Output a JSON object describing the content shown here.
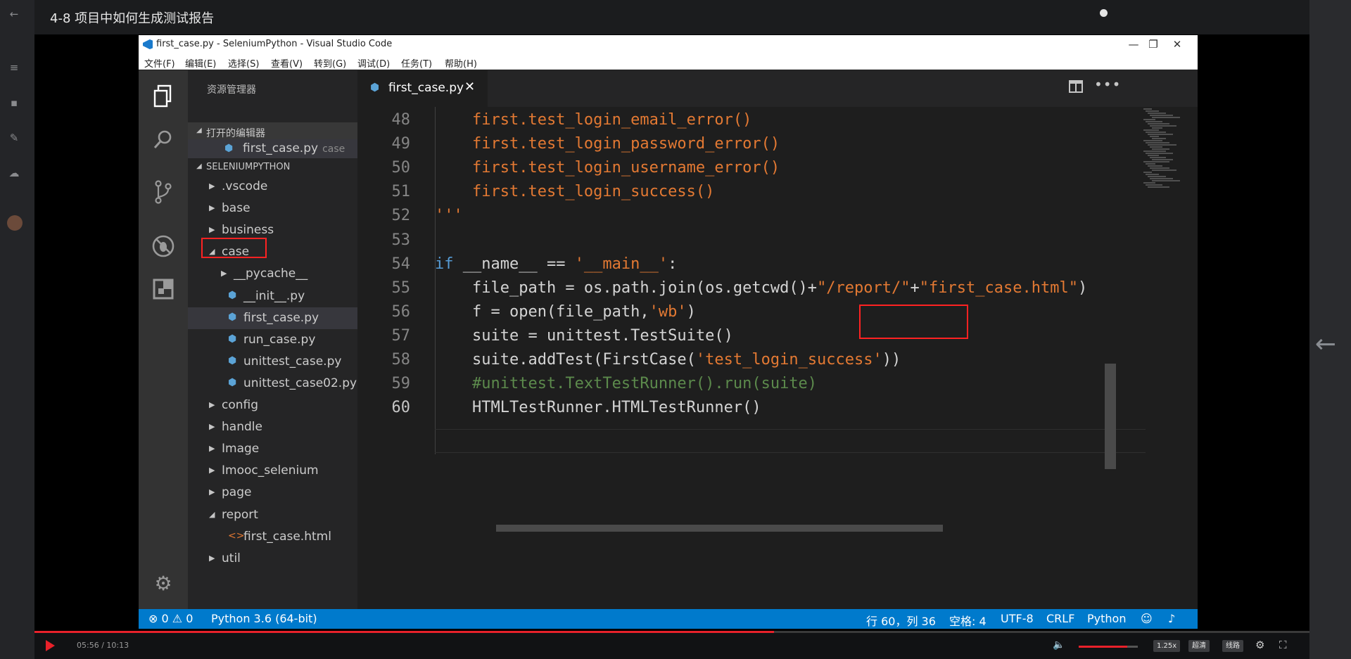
{
  "page": {
    "lesson_title": "4-8 项目中如何生成测试报告"
  },
  "player": {
    "current_time": "05:56",
    "duration": "10:13",
    "time_display": "05:56 / 10:13",
    "progress_fraction": 0.58,
    "volume_fraction": 0.82,
    "speed_label": "1.25x",
    "quality_label": "超清",
    "route_label": "线路",
    "accent_color": "#e8212a"
  },
  "window": {
    "title": "first_case.py - SeleniumPython - Visual Studio Code",
    "minimize": "—",
    "maximize": "❐",
    "close": "✕"
  },
  "menu": [
    "文件(F)",
    "编辑(E)",
    "选择(S)",
    "查看(V)",
    "转到(G)",
    "调试(D)",
    "任务(T)",
    "帮助(H)"
  ],
  "sidebar": {
    "title": "资源管理器",
    "open_editors_label": "打开的编辑器",
    "open_editor": {
      "name": "first_case.py",
      "folder": "case"
    },
    "workspace_label": "SELENIUMPYTHON",
    "tree": [
      {
        "name": ".vscode",
        "kind": "folder",
        "expanded": false
      },
      {
        "name": "base",
        "kind": "folder",
        "expanded": false
      },
      {
        "name": "business",
        "kind": "folder",
        "expanded": false
      },
      {
        "name": "case",
        "kind": "folder",
        "expanded": true
      },
      {
        "name": "__pycache__",
        "kind": "folder",
        "expanded": false
      },
      {
        "name": "__init__.py",
        "kind": "python"
      },
      {
        "name": "first_case.py",
        "kind": "python",
        "selected": true
      },
      {
        "name": "run_case.py",
        "kind": "python"
      },
      {
        "name": "unittest_case.py",
        "kind": "python"
      },
      {
        "name": "unittest_case02.py",
        "kind": "python"
      },
      {
        "name": "config",
        "kind": "folder",
        "expanded": false
      },
      {
        "name": "handle",
        "kind": "folder",
        "expanded": false
      },
      {
        "name": "Image",
        "kind": "folder",
        "expanded": false
      },
      {
        "name": "Imooc_selenium",
        "kind": "folder",
        "expanded": false
      },
      {
        "name": "page",
        "kind": "folder",
        "expanded": false
      },
      {
        "name": "report",
        "kind": "folder",
        "expanded": true
      },
      {
        "name": "first_case.html",
        "kind": "html"
      },
      {
        "name": "util",
        "kind": "folder",
        "expanded": false
      }
    ]
  },
  "editor": {
    "tab_label": "first_case.py",
    "tab_close": "✕",
    "current_line": "60",
    "lines": [
      {
        "n": "48",
        "segs": [
          [
            "fn",
            "    first.test_login_email_error()"
          ]
        ]
      },
      {
        "n": "49",
        "segs": [
          [
            "fn",
            "    first.test_login_password_error()"
          ]
        ]
      },
      {
        "n": "50",
        "segs": [
          [
            "fn",
            "    first.test_login_username_error()"
          ]
        ]
      },
      {
        "n": "51",
        "segs": [
          [
            "fn",
            "    first.test_login_success()"
          ]
        ]
      },
      {
        "n": "52",
        "segs": [
          [
            "str",
            "'''"
          ]
        ]
      },
      {
        "n": "53",
        "segs": []
      },
      {
        "n": "54",
        "segs": [
          [
            "kw",
            "if"
          ],
          [
            "id",
            " __name__ == "
          ],
          [
            "str",
            "'__main__'"
          ],
          [
            "id",
            ":"
          ]
        ]
      },
      {
        "n": "55",
        "segs": [
          [
            "id",
            "    file_path = os.path.join(os.getcwd()+"
          ],
          [
            "str",
            "\"/report/\""
          ],
          [
            "id",
            "+"
          ],
          [
            "str",
            "\"first_case.html\""
          ],
          [
            "id",
            ")"
          ]
        ]
      },
      {
        "n": "56",
        "segs": [
          [
            "id",
            "    f = open(file_path,"
          ],
          [
            "str",
            "'wb'"
          ],
          [
            "id",
            ")"
          ]
        ]
      },
      {
        "n": "57",
        "segs": [
          [
            "id",
            "    suite = unittest.TestSuite()"
          ]
        ]
      },
      {
        "n": "58",
        "segs": [
          [
            "id",
            "    suite.addTest(FirstCase("
          ],
          [
            "str",
            "'test_login_success'"
          ],
          [
            "id",
            "))"
          ]
        ]
      },
      {
        "n": "59",
        "segs": [
          [
            "cm",
            "    #unittest.TextTestRunner().run(suite)"
          ]
        ]
      },
      {
        "n": "60",
        "segs": [
          [
            "id",
            "    HTMLTestRunner.HTMLTestRunner()"
          ]
        ]
      }
    ]
  },
  "statusbar": {
    "errors": "0",
    "warnings": "0",
    "interpreter": "Python 3.6 (64-bit)",
    "position": "行 60，列 36",
    "indent": "空格: 4",
    "encoding": "UTF-8",
    "eol": "CRLF",
    "language": "Python",
    "color": "#007acc"
  },
  "icons": {
    "left_rail": [
      "back-arrow-icon",
      "menu-icon",
      "question-icon",
      "pencil-icon",
      "cloud-icon",
      "avatar"
    ],
    "activity": [
      "files-icon",
      "search-icon",
      "source-control-icon",
      "debug-icon",
      "extensions-icon",
      "gear-icon"
    ]
  }
}
